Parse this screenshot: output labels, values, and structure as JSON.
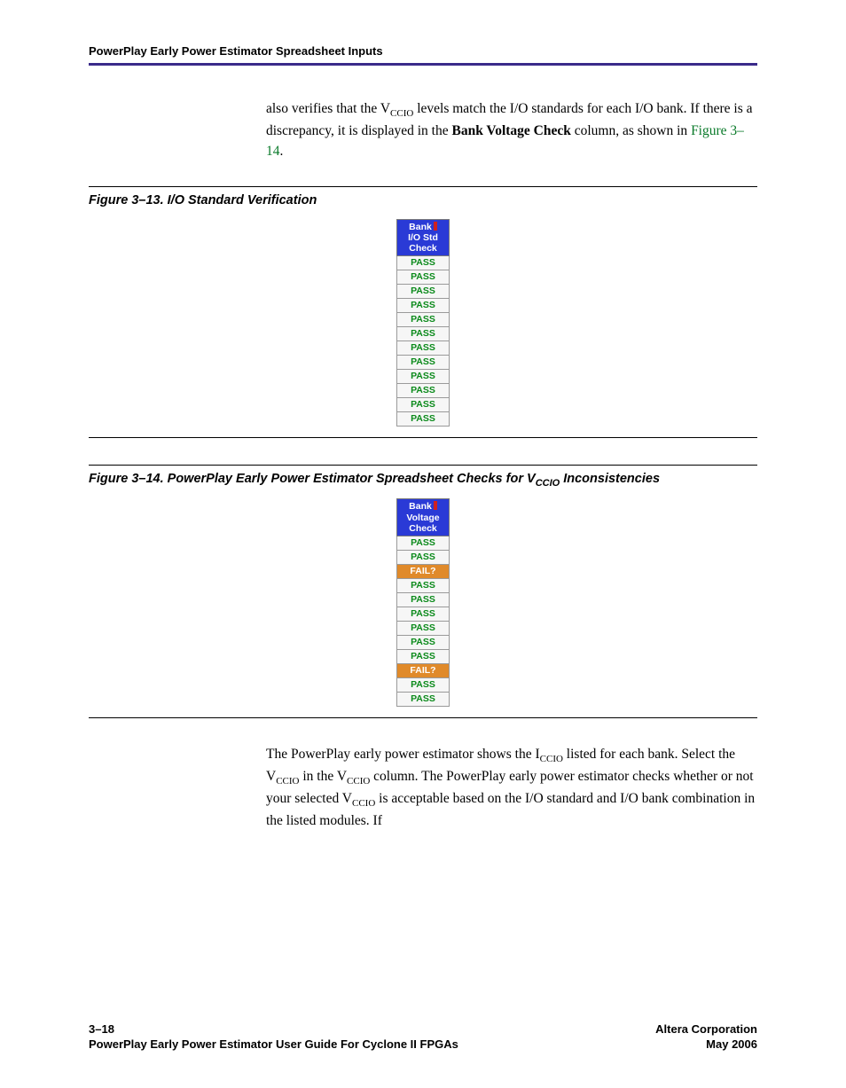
{
  "header": {
    "title": "PowerPlay Early Power Estimator Spreadsheet Inputs"
  },
  "para1": {
    "pre": "also verifies that the V",
    "sub1": "CCIO",
    "mid1": " levels match the I/O standards for each I/O bank. If there is a discrepancy, it is displayed in the ",
    "bold": "Bank Voltage Check",
    "mid2": " column, as shown in ",
    "link": "Figure 3–14",
    "tail": "."
  },
  "fig13": {
    "caption": "Figure 3–13. I/O Standard Verification",
    "header_l1": "Bank",
    "header_l2": "I/O Std",
    "header_l3": "Check",
    "rows": [
      "PASS",
      "PASS",
      "PASS",
      "PASS",
      "PASS",
      "PASS",
      "PASS",
      "PASS",
      "PASS",
      "PASS",
      "PASS",
      "PASS"
    ]
  },
  "fig14": {
    "caption_pre": "Figure 3–14. PowerPlay Early Power Estimator Spreadsheet Checks for V",
    "caption_sub": "CCIO",
    "caption_post": " Inconsistencies",
    "header_l1": "Bank",
    "header_l2": "Voltage",
    "header_l3": "Check",
    "rows": [
      {
        "label": "PASS",
        "status": "pass"
      },
      {
        "label": "PASS",
        "status": "pass"
      },
      {
        "label": "FAIL?",
        "status": "fail"
      },
      {
        "label": "PASS",
        "status": "pass"
      },
      {
        "label": "PASS",
        "status": "pass"
      },
      {
        "label": "PASS",
        "status": "pass"
      },
      {
        "label": "PASS",
        "status": "pass"
      },
      {
        "label": "PASS",
        "status": "pass"
      },
      {
        "label": "PASS",
        "status": "pass"
      },
      {
        "label": "FAIL?",
        "status": "fail"
      },
      {
        "label": "PASS",
        "status": "pass"
      },
      {
        "label": "PASS",
        "status": "pass"
      }
    ]
  },
  "para2": {
    "t1": "The PowerPlay early power estimator shows the I",
    "s1": "CCIO",
    "t2": " listed for each bank. Select the V",
    "s2": "CCIO",
    "t3": " in the V",
    "s3": "CCIO",
    "t4": " column. The PowerPlay early power estimator checks whether or not your selected V",
    "s4": "CCIO",
    "t5": " is acceptable based on the I/O standard and I/O bank combination in the listed modules. If"
  },
  "footer": {
    "left_l1": "3–18",
    "left_l2": "PowerPlay Early Power Estimator User Guide For Cyclone II FPGAs",
    "right_l1": "Altera Corporation",
    "right_l2": "May 2006"
  }
}
